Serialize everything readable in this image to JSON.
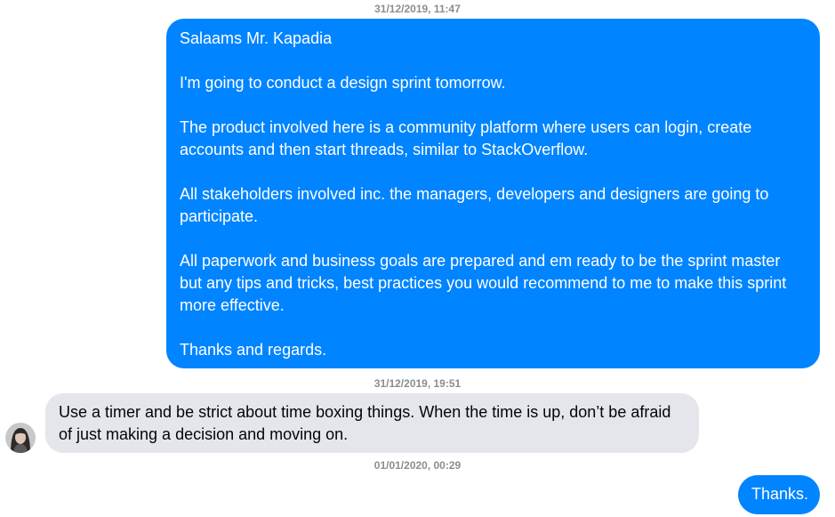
{
  "conversation": {
    "timestamps": {
      "first": "31/12/2019, 11:47",
      "second": "31/12/2019, 19:51",
      "third": "01/01/2020, 00:29"
    },
    "messages": [
      {
        "direction": "outgoing",
        "text": "Salaams Mr. Kapadia\n\nI'm going to conduct a design sprint tomorrow.\n\nThe product involved here is a community platform where users can login, create accounts and then start threads, similar to StackOverflow.\n\nAll stakeholders involved inc. the managers, developers and designers are going to participate.\n\nAll paperwork and business goals are prepared and em ready to be the sprint master but any tips and tricks, best practices you would recommend to me to make this sprint more effective.\n\nThanks and regards."
      },
      {
        "direction": "incoming",
        "text": "Use a timer and be strict about time boxing things. When the time is up, don’t be afraid of just making a decision and moving on."
      },
      {
        "direction": "outgoing",
        "text": "Thanks."
      }
    ]
  },
  "colors": {
    "outgoing_bubble": "#0084ff",
    "incoming_bubble": "#e4e6eb",
    "timestamp_text": "#8a8d91"
  },
  "icons": {
    "avatar": "user-avatar-photo"
  }
}
